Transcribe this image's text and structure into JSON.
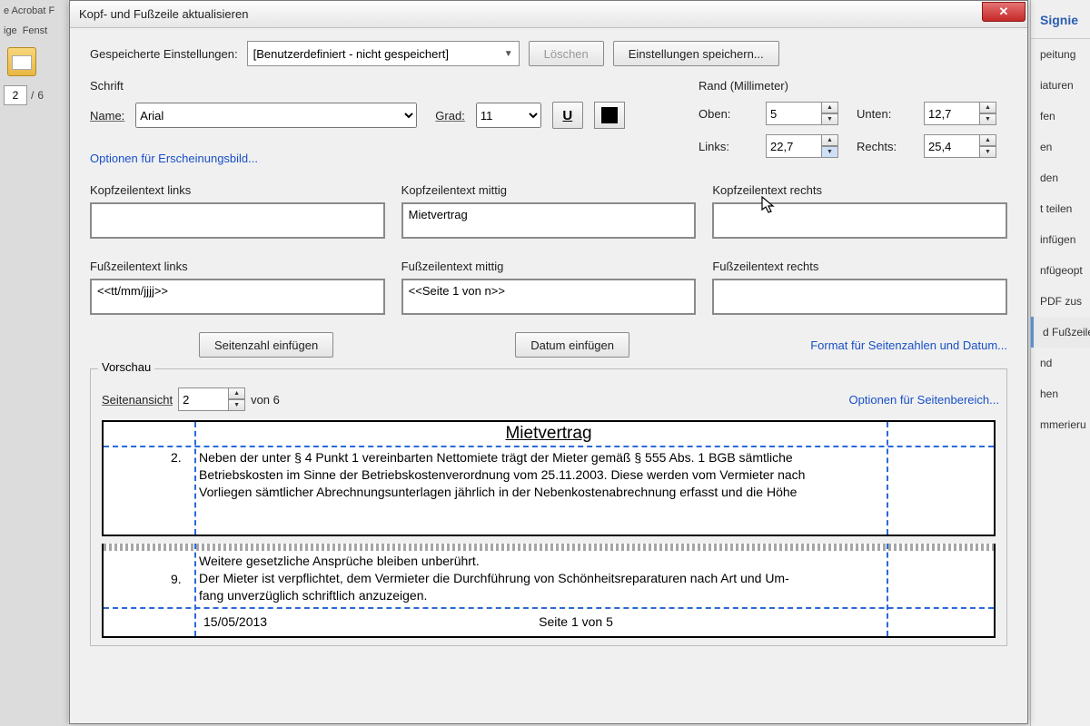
{
  "app": {
    "name_fragment": "e Acrobat F",
    "menu1": "ige",
    "menu2": "Fenst",
    "page_current": "2",
    "page_sep": "/",
    "page_total": "6"
  },
  "right": {
    "sign": "Signie",
    "i1": "peitung",
    "i2": "iaturen",
    "i3": "fen",
    "i4": "en",
    "i5": "den",
    "i6": "t teilen",
    "i7": "infügen",
    "i8": "nfügeopt",
    "i9": "PDF zus",
    "i10": "d Fußzeile",
    "i11": "nd",
    "i12": "hen",
    "i13": "mmerieru"
  },
  "dialog": {
    "title": "Kopf- und Fußzeile aktualisieren",
    "saved_label": "Gespeicherte Einstellungen:",
    "saved_value": "[Benutzerdefiniert - nicht gespeichert]",
    "delete_btn": "Löschen",
    "save_btn": "Einstellungen speichern...",
    "font_group": "Schrift",
    "name_label": "Name:",
    "name_value": "Arial",
    "grad_label": "Grad:",
    "grad_value": "11",
    "underline_btn": "U",
    "margin_group": "Rand (Millimeter)",
    "top_label": "Oben:",
    "top_val": "5",
    "bottom_label": "Unten:",
    "bottom_val": "12,7",
    "left_label": "Links:",
    "left_val": "22,7",
    "right_label": "Rechts:",
    "right_val": "25,4",
    "appearance_link": "Optionen für Erscheinungsbild...",
    "hl": "Kopfzeilentext links",
    "hc": "Kopfzeilentext mittig",
    "hr": "Kopfzeilentext rechts",
    "fl": "Fußzeilentext links",
    "fc": "Fußzeilentext mittig",
    "fr": "Fußzeilentext rechts",
    "hl_v": "",
    "hc_v": "Mietvertrag",
    "hr_v": "",
    "fl_v": "<<tt/mm/jjjj>>",
    "fc_v": "<<Seite 1 von n>>",
    "fr_v": "",
    "insert_page": "Seitenzahl einfügen",
    "insert_date": "Datum einfügen",
    "format_link": "Format für Seitenzahlen und Datum...",
    "preview_lbl": "Vorschau",
    "pageview_lbl": "Seitenansicht",
    "pageview_val": "2",
    "pageview_of": "von 6",
    "pagerange_link": "Optionen für Seitenbereich...",
    "doc": {
      "title": "Mietvertrag",
      "n2": "2.",
      "l2a": "Neben der unter § 4 Punkt 1 vereinbarten Nettomiete trägt der Mieter gemäß § 555 Abs. 1 BGB sämtliche",
      "l2b": "Betriebskosten im Sinne der Betriebskostenverordnung vom 25.11.2003. Diese werden vom Vermieter nach",
      "l2c": "Vorliegen sämtlicher Abrechnungsunterlagen jährlich in der Nebenkostenabrechnung erfasst und die Höhe",
      "footA": "Weitere gesetzliche Ansprüche bleiben unberührt.",
      "n9": "9.",
      "l9a": "Der Mieter ist verpflichtet, dem Vermieter die Durchführung von Schönheitsreparaturen nach Art und Um-",
      "l9b": "fang unverzüglich schriftlich anzuzeigen.",
      "date": "15/05/2013",
      "page": "Seite 1 von 5"
    }
  }
}
